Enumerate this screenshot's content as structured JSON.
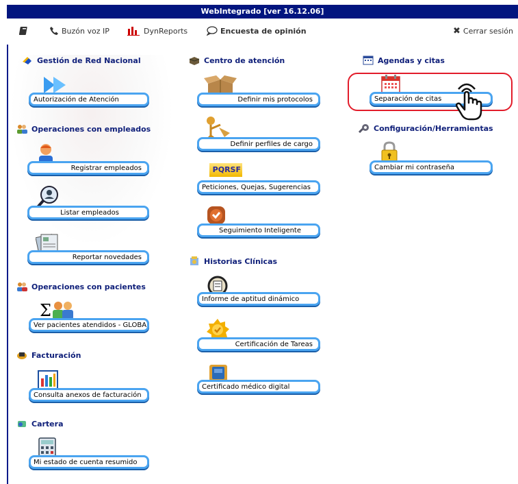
{
  "app": {
    "title": "WebIntegrado [ver 16.12.06]"
  },
  "toolbar": {
    "voip_label": "Buzón voz IP",
    "reports_label": "DynReports",
    "survey_label": "Encuesta de opinión",
    "logout_label": "Cerrar sesión"
  },
  "sections": {
    "red_nacional": "Gestión de Red Nacional",
    "empleados": "Operaciones con empleados",
    "pacientes": "Operaciones con pacientes",
    "facturacion": "Facturación",
    "cartera": "Cartera",
    "centro_atencion": "Centro de atención",
    "historias": "Historias Clínicas",
    "agendas": "Agendas y citas",
    "configuracion": "Configuración/Herramientas"
  },
  "buttons": {
    "autorizacion": "Autorización de Atención",
    "registrar": "Registrar empleados",
    "listar": "Listar empleados",
    "reportar": "Reportar  novedades",
    "ver_pacientes": "Ver pacientes atendidos - GLOBAL",
    "anexos": "Consulta anexos de facturación",
    "estado_cuenta": "Mi estado de cuenta resumido",
    "protocolos": "Definir mis protocolos",
    "perfiles": "Definir perfiles de cargo",
    "pqrsf": "Peticiones, Quejas, Sugerencias",
    "pqrsf_badge": "PQRSF",
    "seguimiento": "Seguimiento Inteligente",
    "informe_aptitud": "Informe de aptitud dinámico",
    "certificacion_tareas": "Certificación de Tareas",
    "certificado_medico": "Certificado médico digital",
    "separacion_citas": "Separación de citas",
    "cambiar_contrasena": "Cambiar mi contraseña"
  },
  "colors": {
    "title_bar": "#02157f",
    "button_border": "#4aa4f0",
    "highlight": "#e21c2a",
    "section_text": "#10207a"
  }
}
